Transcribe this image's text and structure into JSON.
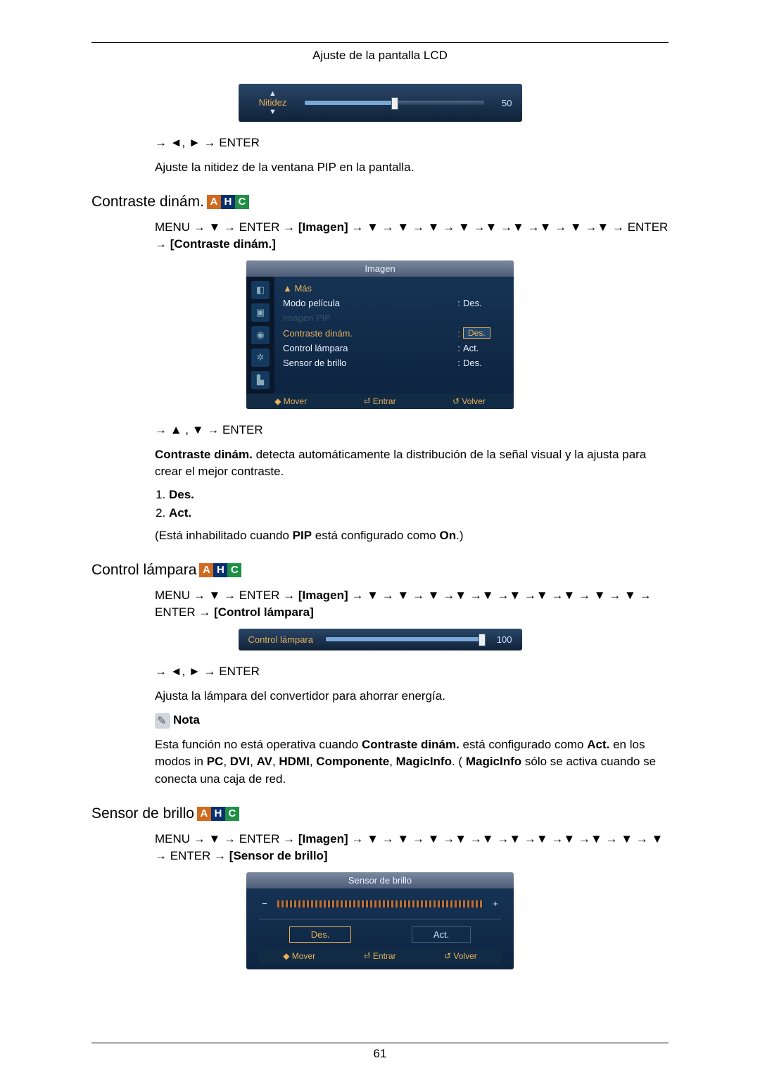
{
  "header_title": "Ajuste de la pantalla LCD",
  "page_number": "61",
  "slider1": {
    "label": "Nitidez",
    "value": "50"
  },
  "nav1": "→ ◄, ► → ENTER",
  "desc1": "Ajuste la nitidez de la ventana PIP en la pantalla.",
  "sec_contraste": {
    "title": "Contraste dinám.",
    "path_a": "MENU → ▼ → ENTER → ",
    "path_bold1": "[Imagen]",
    "path_b": " → ▼ → ▼ → ▼ → ▼ →▼ →▼ →▼ → ▼ →▼ → ENTER → ",
    "path_bold2": "[Contraste dinám.]"
  },
  "osd_menu": {
    "title": "Imagen",
    "more": "▲ Más",
    "rows": {
      "modo": {
        "name": "Modo película",
        "colon": ":",
        "val": "Des."
      },
      "imagenpip": {
        "name": "Imagen PIP"
      },
      "contraste": {
        "name": "Contraste dinám.",
        "colon": ":",
        "val": "Des."
      },
      "control": {
        "name": "Control lámpara",
        "colon": ":",
        "val": "Act."
      },
      "sensor": {
        "name": "Sensor de brillo",
        "colon": ":",
        "val": "Des."
      }
    },
    "footer": {
      "mover": "◆ Mover",
      "entrar": "⏎ Entrar",
      "volver": "↺ Volver"
    }
  },
  "nav2": "→ ▲ , ▼ → ENTER",
  "desc2a": "Contraste dinám.",
  "desc2b": " detecta automáticamente la distribución de la señal visual y la ajusta para crear el mejor contraste.",
  "list": {
    "i1": "Des.",
    "i2": "Act."
  },
  "desc2c_a": "(Está inhabilitado cuando ",
  "desc2c_b": "PIP",
  "desc2c_c": " está configurado como ",
  "desc2c_d": "On",
  "desc2c_e": ".)",
  "sec_lampara": {
    "title": "Control lámpara",
    "path_a": "MENU → ▼ → ENTER → ",
    "path_bold1": "[Imagen]",
    "path_b": " → ▼ → ▼ → ▼ →▼ →▼ →▼ →▼ →▼ → ▼ → ▼ → ENTER → ",
    "path_bold2": "[Control lámpara]"
  },
  "slider2": {
    "label": "Control lámpara",
    "value": "100"
  },
  "nav3": "→ ◄, ► → ENTER",
  "desc3": "Ajusta la lámpara del convertidor para ahorrar energía.",
  "note_label": "Nota",
  "note_a": "Esta función no está operativa cuando ",
  "note_b": "Contraste dinám.",
  "note_c": " está configurado como ",
  "note_d": "Act.",
  "note_e": " en los modos in ",
  "note_f": "PC",
  "note_g": "DVI",
  "note_h": "AV",
  "note_i": "HDMI",
  "note_j": "Componente",
  "note_k": "MagicInfo",
  "note_l": ". ( ",
  "note_m": "MagicInfo",
  "note_n": " sólo se activa cuando se conecta una caja de red.",
  "sep": ", ",
  "sec_sensor": {
    "title": "Sensor de brillo",
    "path_a": "MENU → ▼ → ENTER → ",
    "path_bold1": "[Imagen]",
    "path_b": " → ▼ → ▼ → ▼ →▼ →▼ →▼ →▼ →▼ →▼ → ▼ → ▼ → ENTER → ",
    "path_bold2": "[Sensor de brillo]"
  },
  "osd_sensor": {
    "title": "Sensor de brillo",
    "minus": "−",
    "plus": "+",
    "btn_des": "Des.",
    "btn_act": "Act.",
    "footer": {
      "mover": "◆ Mover",
      "entrar": "⏎ Entrar",
      "volver": "↺ Volver"
    }
  }
}
